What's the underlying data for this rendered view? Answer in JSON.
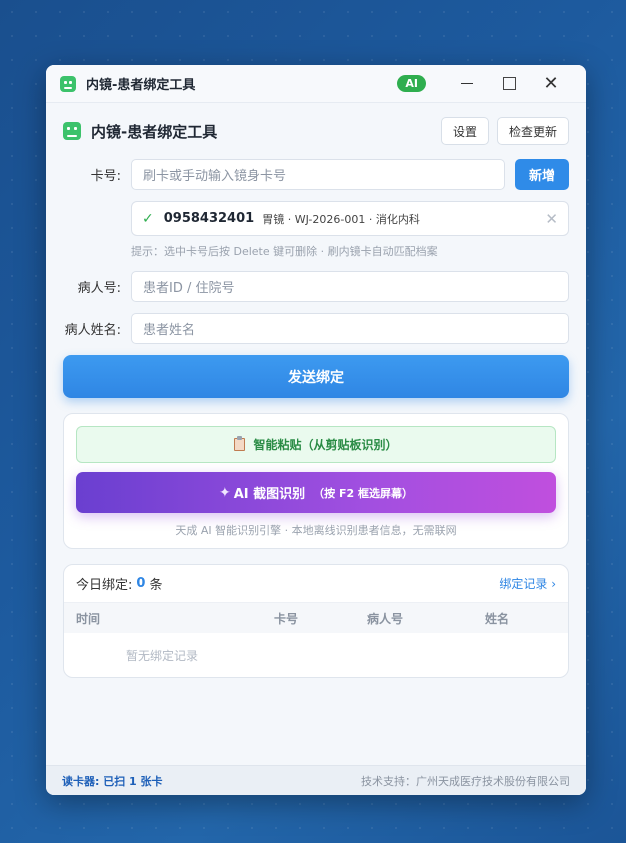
{
  "window": {
    "title": "内镜-患者绑定工具",
    "ai_badge": "AI"
  },
  "header": {
    "title": "内镜-患者绑定工具",
    "settings_label": "设置",
    "check_update_label": "检查更新"
  },
  "form": {
    "card_label": "卡号:",
    "card_placeholder": "刷卡或手动输入镜身卡号",
    "add_label": "新增",
    "selected_card": {
      "number": "0958432401",
      "description": "胃镜 · WJ-2026-001 · 消化内科"
    },
    "hint": "提示：选中卡号后按 Delete 键可删除 · 刷内镜卡自动匹配档案",
    "patient_id_label": "病人号:",
    "patient_id_placeholder": "患者ID / 住院号",
    "patient_name_label": "病人姓名:",
    "patient_name_placeholder": "患者姓名",
    "send_label": "发送绑定"
  },
  "ai_panel": {
    "paste_label": "智能粘贴（从剪贴板识别）",
    "ai_capture_label": "AI 截图识别",
    "ai_capture_sub": "（按 F2 框选屏幕）",
    "engine_note": "天成 AI 智能识别引擎 · 本地离线识别患者信息，无需联网"
  },
  "records": {
    "title_prefix": "今日绑定:",
    "count": "0",
    "title_suffix": "条",
    "link_label": "绑定记录 ›",
    "columns": [
      "时间",
      "卡号",
      "病人号",
      "姓名"
    ],
    "empty_text": "暂无绑定记录"
  },
  "status": {
    "reader": "读卡器: 已扫 1 张卡",
    "support": "技术支持：广州天成医疗技术股份有限公司"
  },
  "colors": {
    "primary": "#2f86e4",
    "success": "#2fae4f",
    "ai_gradient_start": "#6a3fd0",
    "ai_gradient_end": "#c04fde"
  }
}
